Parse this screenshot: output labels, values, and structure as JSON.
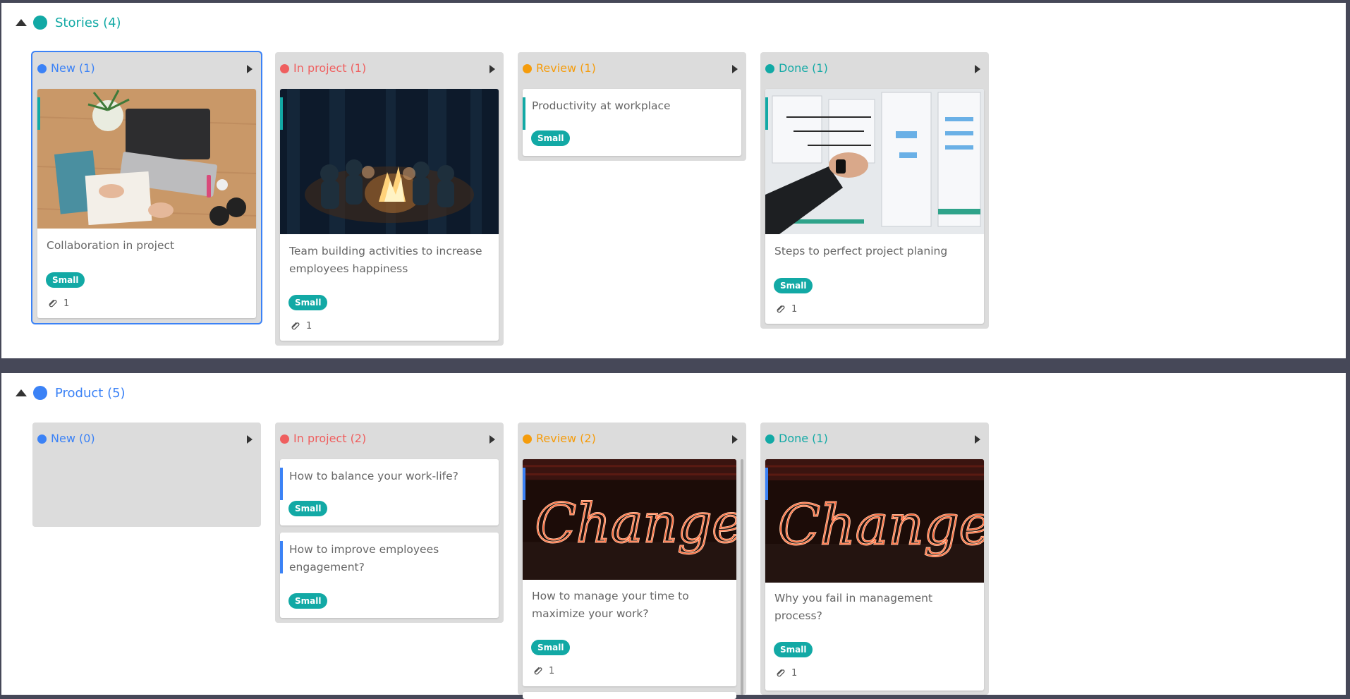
{
  "colors": {
    "teal": "#12a9a5",
    "blue": "#3b82f6",
    "red": "#ef5f5f",
    "orange": "#f59c0c"
  },
  "icons": {
    "collapse": "triangle-up-icon",
    "expand_column": "triangle-right-icon",
    "attachment": "paperclip-icon"
  },
  "groups": [
    {
      "title": "Stories (4)",
      "color": "#12a9a5",
      "columns": [
        {
          "title": "New (1)",
          "color": "#3b82f6",
          "cards": [
            {
              "title": "Collaboration in project",
              "tag": "Small",
              "attachments": "1",
              "image": "desk with laptop and notes"
            }
          ]
        },
        {
          "title": "In project (1)",
          "color": "#ef5f5f",
          "cards": [
            {
              "title": "Team building activities to increase employees happiness",
              "tag": "Small",
              "attachments": "1",
              "image": "campfire at night"
            }
          ]
        },
        {
          "title": "Review (1)",
          "color": "#f59c0c",
          "cards": [
            {
              "title": "Productivity at workplace",
              "tag": "Small"
            }
          ]
        },
        {
          "title": "Done (1)",
          "color": "#12a9a5",
          "cards": [
            {
              "title": "Steps to perfect project planing",
              "tag": "Small",
              "attachments": "1",
              "image": "hand on planning board"
            }
          ]
        }
      ]
    },
    {
      "title": "Product (5)",
      "color": "#3b82f6",
      "columns": [
        {
          "title": "New (0)",
          "color": "#3b82f6",
          "cards": []
        },
        {
          "title": "In project (2)",
          "color": "#ef5f5f",
          "cards": [
            {
              "title": "How to balance your work-life?",
              "tag": "Small"
            },
            {
              "title": "How to improve employees engagement?",
              "tag": "Small"
            }
          ]
        },
        {
          "title": "Review (2)",
          "color": "#f59c0c",
          "cards": [
            {
              "title": "How to manage your time to maximize your work?",
              "tag": "Small",
              "attachments": "1",
              "image": "neon Change sign"
            }
          ]
        },
        {
          "title": "Done (1)",
          "color": "#12a9a5",
          "cards": [
            {
              "title": "Why you fail in management process?",
              "tag": "Small",
              "attachments": "1",
              "image": "neon Change sign"
            }
          ]
        }
      ]
    }
  ]
}
